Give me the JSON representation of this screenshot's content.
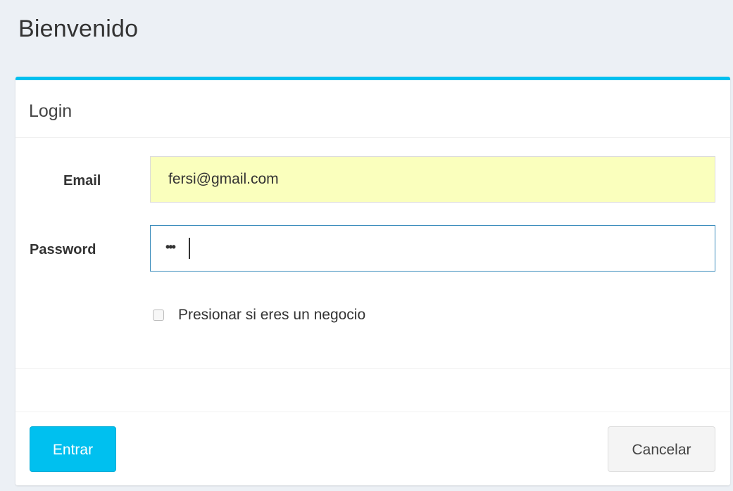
{
  "page": {
    "title": "Bienvenido"
  },
  "login_box": {
    "title": "Login",
    "accent_color": "#00c0ef",
    "email": {
      "label": "Email",
      "value": "fersi@gmail.com"
    },
    "password": {
      "label": "Password",
      "masked_value": "•••"
    },
    "business_checkbox": {
      "label": "Presionar si eres un negocio",
      "checked": false
    },
    "buttons": {
      "submit_label": "Entrar",
      "cancel_label": "Cancelar"
    }
  }
}
